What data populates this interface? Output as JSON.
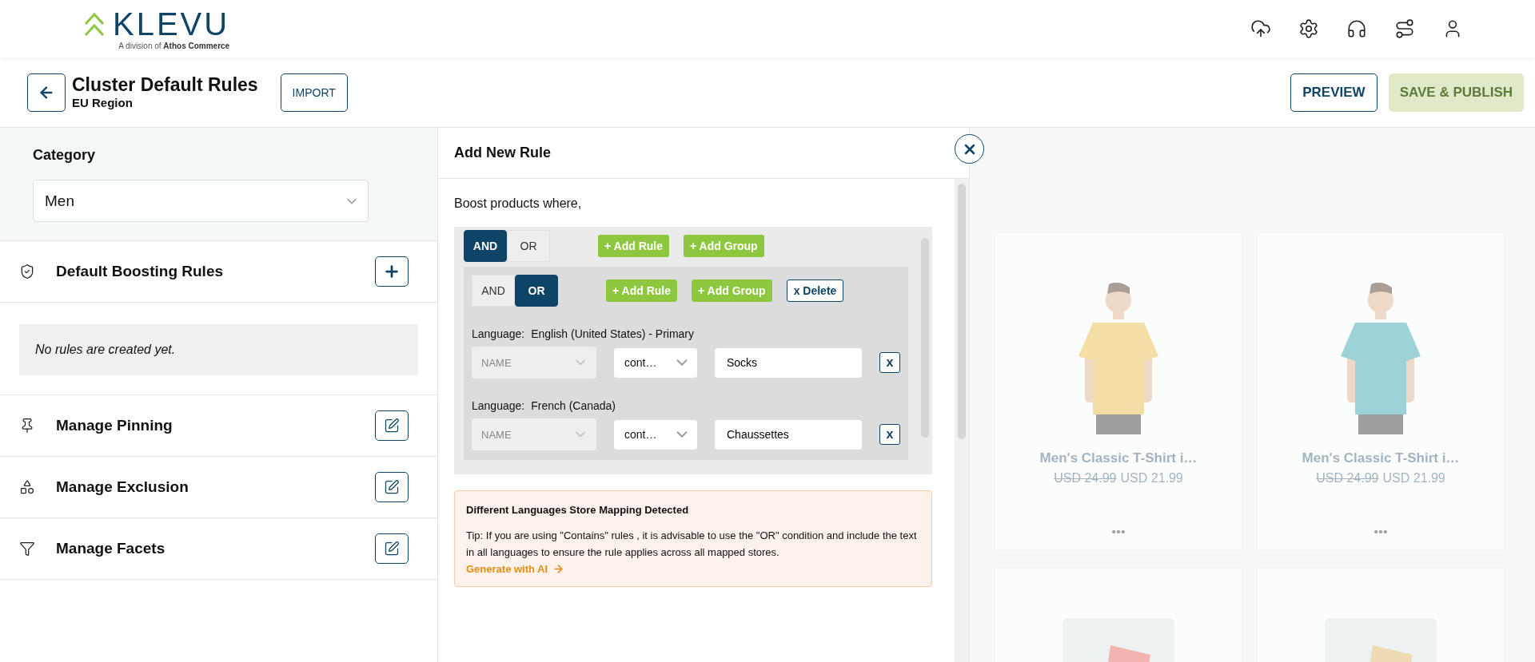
{
  "header": {
    "logo": {
      "name": "KLEVU",
      "tagline": "A division of **Athos Commerce**"
    }
  },
  "page": {
    "title": "Cluster Default Rules",
    "subtitle": "EU Region",
    "import_button": "IMPORT",
    "preview_button": "PREVIEW",
    "publish_button": {
      "label": "SAVE & PUBLISH",
      "disabled": true
    }
  },
  "sidebar": {
    "category_label": "Category",
    "category": {
      "value": "Men"
    },
    "sections": [
      {
        "kind": "add",
        "title": "Default Boosting Rules",
        "empty_message": "No rules are created yet."
      },
      {
        "kind": "edit",
        "title": "Manage Pinning"
      },
      {
        "kind": "edit",
        "title": "Manage Exclusion"
      },
      {
        "kind": "edit",
        "title": "Manage Facets"
      }
    ]
  },
  "modal": {
    "title": "Add New Rule",
    "intro": "Boost products where,",
    "group": {
      "operators": [
        {
          "label": "AND",
          "selected": true
        },
        {
          "label": "OR",
          "selected": false
        }
      ],
      "actions": [
        "+ Add Rule",
        "+ Add Group"
      ],
      "group": {
        "operators": [
          {
            "label": "AND",
            "selected": false
          },
          {
            "label": "OR",
            "selected": true
          }
        ],
        "actions": [
          "+ Add Rule",
          "+ Add Group"
        ],
        "delete": "x Delete",
        "rules": [
          {
            "language_label": "Language:",
            "language": "English (United States) - Primary",
            "field": {
              "placeholder": "NAME",
              "disabled": true
            },
            "operator": "cont…",
            "value": "Socks",
            "remove": "x"
          },
          {
            "language_label": "Language:",
            "language": "French (Canada)",
            "field": {
              "placeholder": "NAME",
              "disabled": true
            },
            "operator": "cont…",
            "value": "Chaussettes",
            "remove": "x"
          }
        ]
      }
    },
    "tip": {
      "title": "Different Languages Store Mapping Detected",
      "text": "Tip: If you are using \"Contains\" rules , it is advisable to use the \"OR\" condition and include the text in all languages to ensure the rule applies across all mapped stores.",
      "link": "Generate with AI"
    }
  },
  "products": [
    {
      "kind": "product",
      "title": "Men's Classic T-Shirt i…",
      "old_price": "USD 24.99",
      "price": "USD 21.99"
    },
    {
      "kind": "product",
      "title": "Men's Classic T-Shirt i…",
      "old_price": "USD 24.99",
      "price": "USD 21.99"
    },
    {
      "kind": "picture"
    },
    {
      "kind": "picture"
    }
  ]
}
